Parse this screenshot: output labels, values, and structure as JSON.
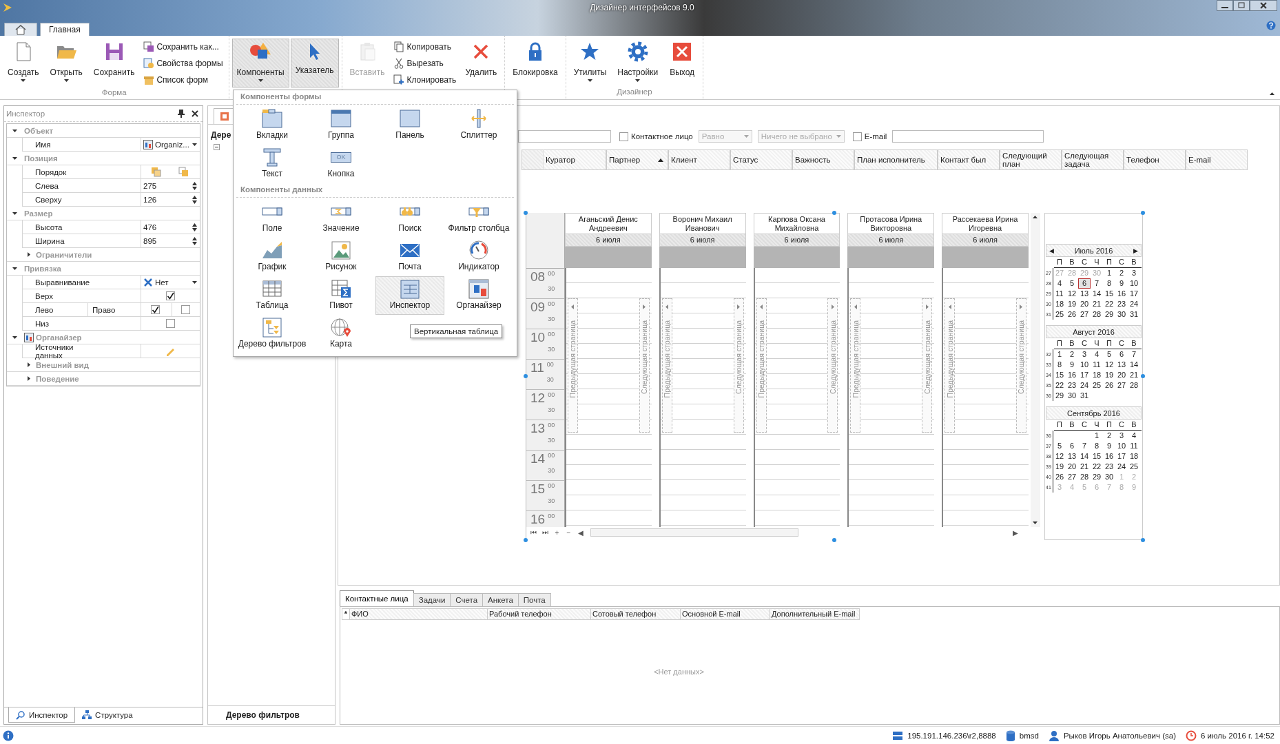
{
  "window": {
    "title": "Дизайнер интерфейсов 9.0"
  },
  "app_tabs": [
    {
      "kind": "home",
      "selected": false
    },
    {
      "kind": "text",
      "label": "Главная",
      "selected": true
    }
  ],
  "ribbon": {
    "groups": [
      {
        "label": "Форма",
        "items": [
          {
            "kind": "large",
            "label": "Создать",
            "has_menu": true,
            "pressed": false,
            "disabled": false
          },
          {
            "kind": "large",
            "label": "Открыть",
            "has_menu": true,
            "pressed": false,
            "disabled": false
          },
          {
            "kind": "large",
            "label": "Сохранить",
            "has_menu": false,
            "pressed": false,
            "disabled": false
          },
          {
            "kind": "stack",
            "items": [
              {
                "label": "Сохранить как..."
              },
              {
                "label": "Свойства формы"
              },
              {
                "label": "Список форм"
              }
            ]
          }
        ]
      },
      {
        "items": [
          {
            "kind": "large",
            "label": "Компоненты",
            "has_menu": true,
            "pressed": true,
            "disabled": false
          },
          {
            "kind": "large",
            "label": "Указатель",
            "has_menu": false,
            "pressed": true,
            "disabled": false
          }
        ]
      },
      {
        "items": [
          {
            "kind": "large",
            "label": "Вставить",
            "has_menu": false,
            "pressed": false,
            "disabled": true
          },
          {
            "kind": "stack",
            "items": [
              {
                "label": "Копировать"
              },
              {
                "label": "Вырезать"
              },
              {
                "label": "Клонировать"
              }
            ]
          },
          {
            "kind": "large",
            "label": "Удалить",
            "has_menu": false,
            "pressed": false,
            "disabled": false
          }
        ]
      },
      {
        "items": [
          {
            "kind": "large",
            "label": "Блокировка",
            "has_menu": false,
            "pressed": false,
            "disabled": false
          }
        ]
      },
      {
        "label": "Дизайнер",
        "items": [
          {
            "kind": "large",
            "label": "Утилиты",
            "has_menu": true,
            "pressed": false,
            "disabled": false
          },
          {
            "kind": "large",
            "label": "Настройки",
            "has_menu": true,
            "pressed": false,
            "disabled": false
          },
          {
            "kind": "large",
            "label": "Выход",
            "has_menu": false,
            "pressed": false,
            "disabled": false
          }
        ]
      }
    ]
  },
  "inspector": {
    "title": "Инспектор",
    "categories": [
      {
        "label": "Объект",
        "kind": "plain",
        "expanded": true,
        "children": [
          {
            "kind": "dropdown",
            "name": "Имя",
            "value": "Organiz..."
          }
        ]
      },
      {
        "label": "Позиция",
        "kind": "plain",
        "expanded": true,
        "children": [
          {
            "kind": "order",
            "name": "Порядок"
          },
          {
            "kind": "spin",
            "name": "Слева",
            "value": "275"
          },
          {
            "kind": "spin",
            "name": "Сверху",
            "value": "126"
          }
        ]
      },
      {
        "label": "Размер",
        "kind": "plain",
        "expanded": true,
        "children": [
          {
            "kind": "spin",
            "name": "Высота",
            "value": "476"
          },
          {
            "kind": "spin",
            "name": "Ширина",
            "value": "895"
          },
          {
            "kind": "category",
            "label": "Ограничители",
            "expanded": false
          }
        ]
      },
      {
        "label": "Привязка",
        "kind": "plain",
        "expanded": true,
        "children": [
          {
            "kind": "align",
            "name": "Выравнивание",
            "value": "Нет"
          },
          {
            "kind": "check",
            "name": "Верх",
            "checked": true
          },
          {
            "kind": "checkpair",
            "name": "Лево",
            "name2": "Право",
            "checked": true,
            "checked2": false
          },
          {
            "kind": "check",
            "name": "Низ",
            "checked": false
          }
        ]
      },
      {
        "label": "Органайзер",
        "kind": "component",
        "expanded": true,
        "children": [
          {
            "kind": "edit",
            "name": "Источники данных"
          },
          {
            "kind": "category",
            "label": "Внешний вид",
            "expanded": false
          },
          {
            "kind": "category",
            "label": "Поведение",
            "expanded": false
          }
        ]
      }
    ]
  },
  "left_tabs": [
    {
      "label": "Инспектор",
      "selected": true
    },
    {
      "label": "Структура",
      "selected": false
    }
  ],
  "filter_panel": {
    "tree_title": "Дере",
    "footer": "Дерево фильтров"
  },
  "filter_bar": [
    {
      "kind": "field"
    },
    {
      "kind": "check",
      "label": "Контактное лицо",
      "checked": false
    },
    {
      "kind": "select",
      "value": "Равно",
      "disabled": true
    },
    {
      "kind": "select",
      "value": "Ничего не выбрано",
      "disabled": true
    },
    {
      "kind": "check",
      "label": "E-mail",
      "checked": false
    },
    {
      "kind": "field"
    }
  ],
  "grid_columns": [
    {
      "label": "Куратор",
      "sorted": false
    },
    {
      "label": "Партнер",
      "sorted": true
    },
    {
      "label": "Клиент",
      "sorted": false
    },
    {
      "label": "Статус",
      "sorted": false
    },
    {
      "label": "Важность",
      "sorted": false
    },
    {
      "label": "План исполнитель",
      "sorted": false
    },
    {
      "label": "Контакт был",
      "sorted": false
    },
    {
      "label": "Следующий план",
      "sorted": false
    },
    {
      "label": "Следующая задача",
      "sorted": false
    },
    {
      "label": "Телефон",
      "sorted": false
    },
    {
      "label": "E-mail",
      "sorted": false
    }
  ],
  "scheduler": {
    "resources": [
      {
        "name": "Аганьский Денис Андреевич",
        "date": "6 июля",
        "prev": "Предыдущая страница",
        "next": "Следующая страница"
      },
      {
        "name": "Воронич Михаил Иванович",
        "date": "6 июля",
        "prev": "Предыдущая страница",
        "next": "Следующая страница"
      },
      {
        "name": "Карпова Оксана Михайловна",
        "date": "6 июля",
        "prev": "Предыдущая страница",
        "next": "Следующая страница"
      },
      {
        "name": "Протасова Ирина Викторовна",
        "date": "6 июля",
        "prev": "Предыдущая страница",
        "next": "Следующая страница"
      },
      {
        "name": "Рассекаева Ирина Игоревна",
        "date": "6 июля",
        "prev": "Предыдущая страница",
        "next": "Следующая страница"
      }
    ],
    "hours": [
      {
        "hour": "08",
        "minutes": [
          "00",
          "30"
        ]
      },
      {
        "hour": "09",
        "minutes": [
          "00",
          "30"
        ]
      },
      {
        "hour": "10",
        "minutes": [
          "00",
          "30"
        ]
      },
      {
        "hour": "11",
        "minutes": [
          "00",
          "30"
        ]
      },
      {
        "hour": "12",
        "minutes": [
          "00",
          "30"
        ]
      },
      {
        "hour": "13",
        "minutes": [
          "00",
          "30"
        ]
      },
      {
        "hour": "14",
        "minutes": [
          "00",
          "30"
        ]
      },
      {
        "hour": "15",
        "minutes": [
          "00",
          "30"
        ]
      },
      {
        "hour": "16",
        "minutes": [
          "00"
        ]
      }
    ],
    "nav": [
      "⏮",
      "⏭",
      "+",
      "−"
    ],
    "scroll": [
      "◀",
      "▶"
    ],
    "calendar": {
      "months": [
        {
          "title": "Июль 2016",
          "prev": "◀",
          "next": "▶",
          "weekdays": [
            "П",
            "В",
            "С",
            "Ч",
            "П",
            "С",
            "В"
          ],
          "weeks": [
            {
              "week": "27",
              "days": [
                {
                  "day": "27",
                  "muted": true,
                  "selected": false
                },
                {
                  "day": "28",
                  "muted": true,
                  "selected": false
                },
                {
                  "day": "29",
                  "muted": true,
                  "selected": false
                },
                {
                  "day": "30",
                  "muted": true,
                  "selected": false
                },
                {
                  "day": "1",
                  "muted": false,
                  "selected": false
                },
                {
                  "day": "2",
                  "muted": false,
                  "selected": false
                },
                {
                  "day": "3",
                  "muted": false,
                  "selected": false
                }
              ]
            },
            {
              "week": "28",
              "days": [
                {
                  "day": "4",
                  "muted": false,
                  "selected": false
                },
                {
                  "day": "5",
                  "muted": false,
                  "selected": false
                },
                {
                  "day": "6",
                  "muted": false,
                  "selected": true
                },
                {
                  "day": "7",
                  "muted": false,
                  "selected": false
                },
                {
                  "day": "8",
                  "muted": false,
                  "selected": false
                },
                {
                  "day": "9",
                  "muted": false,
                  "selected": false
                },
                {
                  "day": "10",
                  "muted": false,
                  "selected": false
                }
              ]
            },
            {
              "week": "29",
              "days": [
                {
                  "day": "11",
                  "muted": false,
                  "selected": false
                },
                {
                  "day": "12",
                  "muted": false,
                  "selected": false
                },
                {
                  "day": "13",
                  "muted": false,
                  "selected": false
                },
                {
                  "day": "14",
                  "muted": false,
                  "selected": false
                },
                {
                  "day": "15",
                  "muted": false,
                  "selected": false
                },
                {
                  "day": "16",
                  "muted": false,
                  "selected": false
                },
                {
                  "day": "17",
                  "muted": false,
                  "selected": false
                }
              ]
            },
            {
              "week": "30",
              "days": [
                {
                  "day": "18",
                  "muted": false,
                  "selected": false
                },
                {
                  "day": "19",
                  "muted": false,
                  "selected": false
                },
                {
                  "day": "20",
                  "muted": false,
                  "selected": false
                },
                {
                  "day": "21",
                  "muted": false,
                  "selected": false
                },
                {
                  "day": "22",
                  "muted": false,
                  "selected": false
                },
                {
                  "day": "23",
                  "muted": false,
                  "selected": false
                },
                {
                  "day": "24",
                  "muted": false,
                  "selected": false
                }
              ]
            },
            {
              "week": "31",
              "days": [
                {
                  "day": "25",
                  "muted": false,
                  "selected": false
                },
                {
                  "day": "26",
                  "muted": false,
                  "selected": false
                },
                {
                  "day": "27",
                  "muted": false,
                  "selected": false
                },
                {
                  "day": "28",
                  "muted": false,
                  "selected": false
                },
                {
                  "day": "29",
                  "muted": false,
                  "selected": false
                },
                {
                  "day": "30",
                  "muted": false,
                  "selected": false
                },
                {
                  "day": "31",
                  "muted": false,
                  "selected": false
                }
              ]
            }
          ]
        },
        {
          "title": "Август 2016",
          "weekdays": [
            "П",
            "В",
            "С",
            "Ч",
            "П",
            "С",
            "В"
          ],
          "weeks": [
            {
              "week": "32",
              "days": [
                {
                  "day": "1",
                  "muted": false,
                  "selected": false
                },
                {
                  "day": "2",
                  "muted": false,
                  "selected": false
                },
                {
                  "day": "3",
                  "muted": false,
                  "selected": false
                },
                {
                  "day": "4",
                  "muted": false,
                  "selected": false
                },
                {
                  "day": "5",
                  "muted": false,
                  "selected": false
                },
                {
                  "day": "6",
                  "muted": false,
                  "selected": false
                },
                {
                  "day": "7",
                  "muted": false,
                  "selected": false
                }
              ]
            },
            {
              "week": "33",
              "days": [
                {
                  "day": "8",
                  "muted": false,
                  "selected": false
                },
                {
                  "day": "9",
                  "muted": false,
                  "selected": false
                },
                {
                  "day": "10",
                  "muted": false,
                  "selected": false
                },
                {
                  "day": "11",
                  "muted": false,
                  "selected": false
                },
                {
                  "day": "12",
                  "muted": false,
                  "selected": false
                },
                {
                  "day": "13",
                  "muted": false,
                  "selected": false
                },
                {
                  "day": "14",
                  "muted": false,
                  "selected": false
                }
              ]
            },
            {
              "week": "34",
              "days": [
                {
                  "day": "15",
                  "muted": false,
                  "selected": false
                },
                {
                  "day": "16",
                  "muted": false,
                  "selected": false
                },
                {
                  "day": "17",
                  "muted": false,
                  "selected": false
                },
                {
                  "day": "18",
                  "muted": false,
                  "selected": false
                },
                {
                  "day": "19",
                  "muted": false,
                  "selected": false
                },
                {
                  "day": "20",
                  "muted": false,
                  "selected": false
                },
                {
                  "day": "21",
                  "muted": false,
                  "selected": false
                }
              ]
            },
            {
              "week": "35",
              "days": [
                {
                  "day": "22",
                  "muted": false,
                  "selected": false
                },
                {
                  "day": "23",
                  "muted": false,
                  "selected": false
                },
                {
                  "day": "24",
                  "muted": false,
                  "selected": false
                },
                {
                  "day": "25",
                  "muted": false,
                  "selected": false
                },
                {
                  "day": "26",
                  "muted": false,
                  "selected": false
                },
                {
                  "day": "27",
                  "muted": false,
                  "selected": false
                },
                {
                  "day": "28",
                  "muted": false,
                  "selected": false
                }
              ]
            },
            {
              "week": "36",
              "kind": "ends_early",
              "days": [
                {
                  "day": "29",
                  "muted": false,
                  "selected": false
                },
                {
                  "day": "30",
                  "muted": false,
                  "selected": false
                },
                {
                  "day": "31",
                  "muted": false,
                  "selected": false
                }
              ]
            }
          ]
        },
        {
          "title": "Сентябрь 2016",
          "weekdays": [
            "П",
            "В",
            "С",
            "Ч",
            "П",
            "С",
            "В"
          ],
          "weeks": [
            {
              "week": "36",
              "kind": "starts_late",
              "days": [
                {
                  "day": "1",
                  "muted": false,
                  "selected": false
                },
                {
                  "day": "2",
                  "muted": false,
                  "selected": false
                },
                {
                  "day": "3",
                  "muted": false,
                  "selected": false
                },
                {
                  "day": "4",
                  "muted": false,
                  "selected": false
                }
              ]
            },
            {
              "week": "37",
              "days": [
                {
                  "day": "5",
                  "muted": false,
                  "selected": false
                },
                {
                  "day": "6",
                  "muted": false,
                  "selected": false
                },
                {
                  "day": "7",
                  "muted": false,
                  "selected": false
                },
                {
                  "day": "8",
                  "muted": false,
                  "selected": false
                },
                {
                  "day": "9",
                  "muted": false,
                  "selected": false
                },
                {
                  "day": "10",
                  "muted": false,
                  "selected": false
                },
                {
                  "day": "11",
                  "muted": false,
                  "selected": false
                }
              ]
            },
            {
              "week": "38",
              "days": [
                {
                  "day": "12",
                  "muted": false,
                  "selected": false
                },
                {
                  "day": "13",
                  "muted": false,
                  "selected": false
                },
                {
                  "day": "14",
                  "muted": false,
                  "selected": false
                },
                {
                  "day": "15",
                  "muted": false,
                  "selected": false
                },
                {
                  "day": "16",
                  "muted": false,
                  "selected": false
                },
                {
                  "day": "17",
                  "muted": false,
                  "selected": false
                },
                {
                  "day": "18",
                  "muted": false,
                  "selected": false
                }
              ]
            },
            {
              "week": "39",
              "days": [
                {
                  "day": "19",
                  "muted": false,
                  "selected": false
                },
                {
                  "day": "20",
                  "muted": false,
                  "selected": false
                },
                {
                  "day": "21",
                  "muted": false,
                  "selected": false
                },
                {
                  "day": "22",
                  "muted": false,
                  "selected": false
                },
                {
                  "day": "23",
                  "muted": false,
                  "selected": false
                },
                {
                  "day": "24",
                  "muted": false,
                  "selected": false
                },
                {
                  "day": "25",
                  "muted": false,
                  "selected": false
                }
              ]
            },
            {
              "week": "40",
              "days": [
                {
                  "day": "26",
                  "muted": false,
                  "selected": false
                },
                {
                  "day": "27",
                  "muted": false,
                  "selected": false
                },
                {
                  "day": "28",
                  "muted": false,
                  "selected": false
                },
                {
                  "day": "29",
                  "muted": false,
                  "selected": false
                },
                {
                  "day": "30",
                  "muted": false,
                  "selected": false
                },
                {
                  "day": "1",
                  "muted": true,
                  "selected": false
                },
                {
                  "day": "2",
                  "muted": true,
                  "selected": false
                }
              ]
            },
            {
              "week": "41",
              "days": [
                {
                  "day": "3",
                  "muted": true,
                  "selected": false
                },
                {
                  "day": "4",
                  "muted": true,
                  "selected": false
                },
                {
                  "day": "5",
                  "muted": true,
                  "selected": false
                },
                {
                  "day": "6",
                  "muted": true,
                  "selected": false
                },
                {
                  "day": "7",
                  "muted": true,
                  "selected": false
                },
                {
                  "day": "8",
                  "muted": true,
                  "selected": false
                },
                {
                  "day": "9",
                  "muted": true,
                  "selected": false
                }
              ]
            }
          ]
        }
      ]
    }
  },
  "bottom_panel": {
    "tabs": [
      {
        "label": "Контактные лица",
        "selected": true
      },
      {
        "label": "Задачи",
        "selected": false
      },
      {
        "label": "Счета",
        "selected": false
      },
      {
        "label": "Анкета",
        "selected": false
      },
      {
        "label": "Почта",
        "selected": false
      }
    ],
    "marker": "*",
    "columns": [
      "ФИО",
      "Рабочий телефон",
      "Сотовый телефон",
      "Основной E-mail",
      "Дополнительный E-mail"
    ],
    "empty_text": "<Нет данных>"
  },
  "status_bar": [
    "195.191.146.236\\r2,8888",
    "bmsd",
    "Рыков Игорь Анатольевич (sa)",
    "6 июль 2016 г. 14:52"
  ],
  "menu": {
    "sections": [
      {
        "title": "Компоненты формы",
        "items": [
          {
            "label": "Вкладки",
            "hovered": false
          },
          {
            "label": "Группа",
            "hovered": false
          },
          {
            "label": "Панель",
            "hovered": false
          },
          {
            "label": "Сплиттер",
            "hovered": false
          },
          {
            "label": "Текст",
            "hovered": false
          },
          {
            "label": "Кнопка",
            "icon_text": "OK",
            "hovered": false
          }
        ]
      },
      {
        "title": "Компоненты данных",
        "items": [
          {
            "label": "Поле",
            "hovered": false
          },
          {
            "label": "Значение",
            "hovered": false
          },
          {
            "label": "Поиск",
            "hovered": false
          },
          {
            "label": "Фильтр столбца",
            "hovered": false
          },
          {
            "label": "График",
            "hovered": false
          },
          {
            "label": "Рисунок",
            "hovered": false
          },
          {
            "label": "Почта",
            "hovered": false
          },
          {
            "label": "Индикатор",
            "hovered": false
          },
          {
            "label": "Таблица",
            "hovered": false
          },
          {
            "label": "Пивот",
            "hovered": false
          },
          {
            "label": "Инспектор",
            "hovered": true
          },
          {
            "label": "Органайзер",
            "hovered": false
          },
          {
            "label": "Дерево фильтров",
            "hovered": false
          },
          {
            "label": "Карта",
            "hovered": false
          }
        ]
      }
    ],
    "tooltip": "Вертикальная таблица"
  }
}
